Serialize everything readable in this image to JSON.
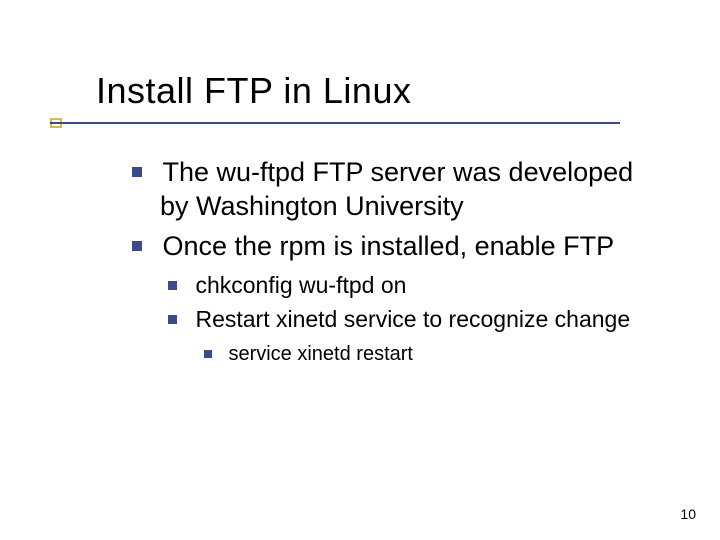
{
  "title": "Install FTP in Linux",
  "bullets": {
    "lvl1": [
      "The wu-ftpd FTP server was developed by Washington University",
      "Once the rpm is installed, enable FTP"
    ],
    "lvl2": [
      "chkconfig wu-ftpd on",
      "Restart xinetd service to recognize change"
    ],
    "lvl3": [
      "service xinetd restart"
    ]
  },
  "page_number": "10"
}
